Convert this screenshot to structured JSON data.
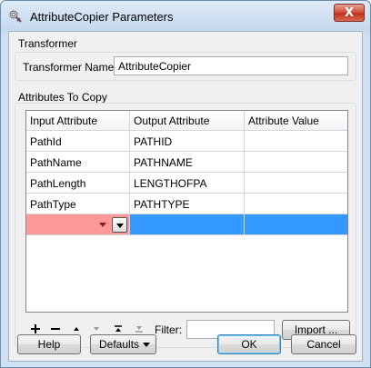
{
  "window": {
    "title": "AttributeCopier Parameters",
    "close_label": "X"
  },
  "transformer": {
    "group_title": "Transformer",
    "name_label": "Transformer Name:",
    "name_value": "AttributeCopier"
  },
  "attributes": {
    "group_title": "Attributes To Copy",
    "columns": [
      "Input Attribute",
      "Output Attribute",
      "Attribute Value"
    ],
    "rows": [
      [
        "PathId",
        "PATHID",
        ""
      ],
      [
        "PathName",
        "PATHNAME",
        ""
      ],
      [
        "PathLength",
        "LENGTHOFPA",
        ""
      ],
      [
        "PathType",
        "PATHTYPE",
        ""
      ]
    ]
  },
  "toolbar": {
    "add_icon": "plus-icon",
    "remove_icon": "minus-icon",
    "filter_label": "Filter:",
    "filter_value": "",
    "import_label": "Import ..."
  },
  "footer": {
    "help_label": "Help",
    "defaults_label": "Defaults",
    "ok_label": "OK",
    "cancel_label": "Cancel"
  }
}
